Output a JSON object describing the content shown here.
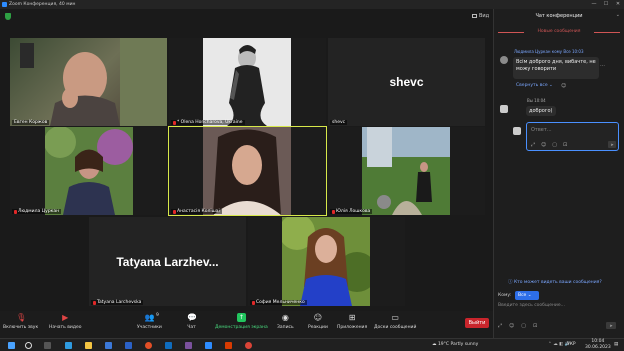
{
  "window": {
    "title": "Zoom Конференция, 40 мин"
  },
  "meeting": {
    "view_label": "Вид",
    "participants": [
      {
        "name": "Евген Коржов"
      },
      {
        "name": "* Olena Honcharova, Ukraine"
      },
      {
        "name": "shevc",
        "display_name": "shevc"
      },
      {
        "name": "Людмила Цуркан"
      },
      {
        "name": "Анастасія Колішаі"
      },
      {
        "name": "Юлія Лошкова"
      },
      {
        "name": "Tatyana Larchevska",
        "display_name": "Tatyana  Larzhev..."
      },
      {
        "name": "София Мельниченко"
      }
    ]
  },
  "toolbar": {
    "items": [
      {
        "label": "Включить звук",
        "icon": "mic-off-icon"
      },
      {
        "label": "Начать видео",
        "icon": "video-off-icon"
      },
      {
        "label": "Участники",
        "icon": "participants-icon",
        "badge": "9"
      },
      {
        "label": "Чат",
        "icon": "chat-icon"
      },
      {
        "label": "Демонстрация экрана",
        "icon": "share-screen-icon"
      },
      {
        "label": "Запись",
        "icon": "record-icon"
      },
      {
        "label": "Реакции",
        "icon": "reactions-icon"
      },
      {
        "label": "Приложения",
        "icon": "apps-icon"
      },
      {
        "label": "Доски сообщений",
        "icon": "whiteboard-icon"
      }
    ],
    "end_label": "Выйти",
    "accent": "#22c55e",
    "end_color": "#c9252c"
  },
  "chat": {
    "title": "Чат конференции",
    "new_messages": "Новые сообщения",
    "msg1_meta": "Людмила Цуркан кому Все 10:03",
    "msg1_text": "Всім доброго дня, вибачте, не можу говорити",
    "collapse_label": "Свернуть все",
    "msg2_meta": "Вы 10:04",
    "msg2_text": "доброго)",
    "input_placeholder": "Ответ...",
    "who_can_see": "Кто может видеть ваши сообщения?",
    "to_label": "Кому:",
    "to_value": "Все",
    "message_placeholder": "Введите здесь сообщение..."
  },
  "taskbar": {
    "weather": "19°C  Partly sunny",
    "lang": "УКР",
    "time": "10:04",
    "date": "30.06.2023"
  }
}
